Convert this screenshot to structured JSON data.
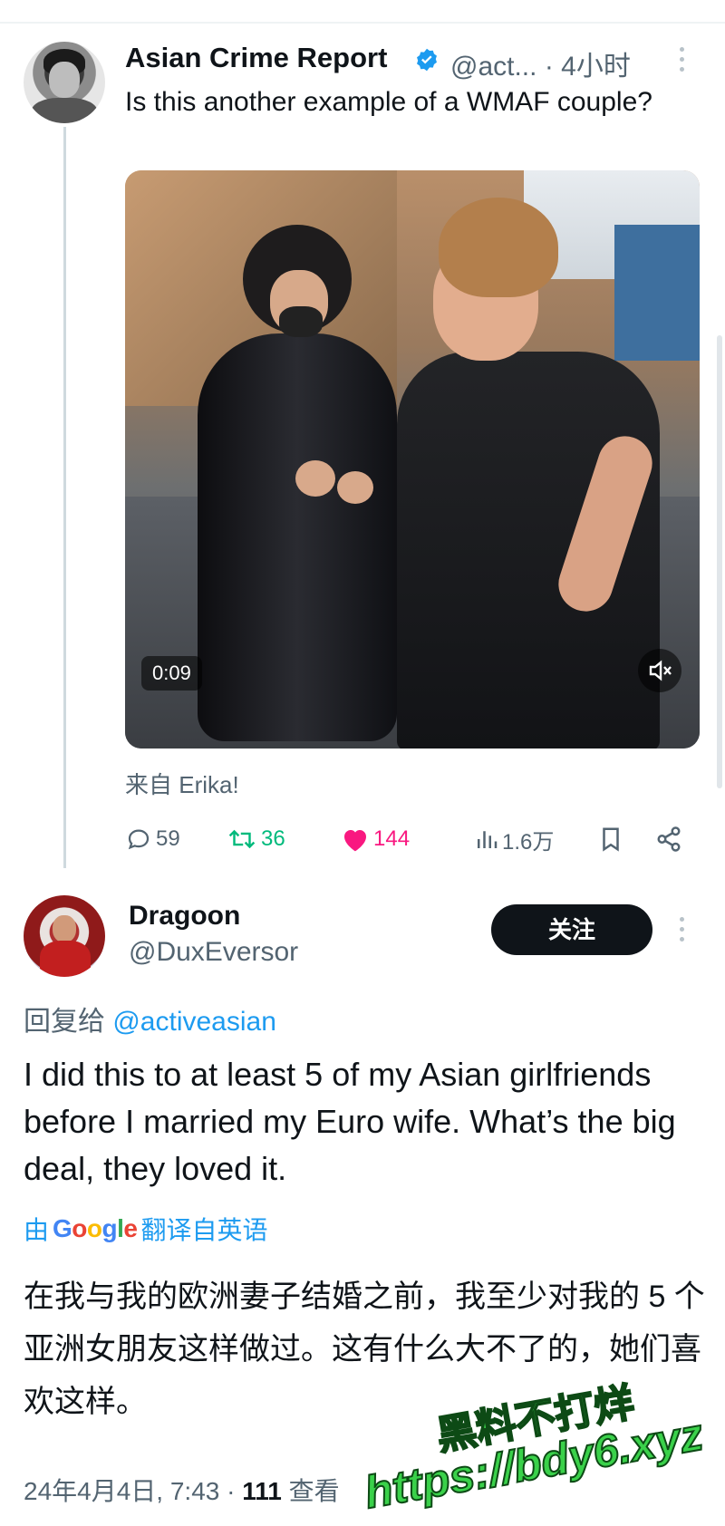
{
  "main_tweet": {
    "author_name": "Asian Crime Report",
    "handle_time": "@act... · 4小时",
    "text": "Is this another example of a WMAF couple?",
    "video": {
      "duration": "0:09"
    },
    "source": "来自 Erika!",
    "actions": {
      "replies": "59",
      "retweets": "36",
      "likes": "144",
      "views": "1.6万"
    }
  },
  "reply_tweet": {
    "author_name": "Dragoon",
    "handle": "@DuxEversor",
    "follow_label": "关注",
    "reply_prefix": "回复给",
    "reply_mention": "@activeasian",
    "text": "I did this to at least 5 of my Asian girlfriends before I married my Euro wife. What’s the big deal, they loved it.",
    "translate_prefix": "由",
    "translate_brand": "Google",
    "translate_suffix": "翻译自英语",
    "translated_text": "在我与我的欧洲妻子结婚之前，我至少对我的 5 个亚洲女朋友这样做过。这有什么大不了的，她们喜欢这样。",
    "meta_datetime": "24年4月4日, 7:43 · ",
    "meta_views": "111",
    "meta_views_label": " 查看"
  },
  "watermark": {
    "line1": "黑料不打烊",
    "line2": "https://bdy6.xyz"
  },
  "colors": {
    "accent": "#1d9bf0",
    "retweet": "#00ba7c",
    "like": "#f91880",
    "text": "#0f1419",
    "secondary": "#536471",
    "watermark": "#3ad14a"
  },
  "icons": [
    "verified-badge-icon",
    "more-icon",
    "reply-icon",
    "retweet-icon",
    "like-icon",
    "views-icon",
    "bookmark-icon",
    "share-icon",
    "mute-icon"
  ]
}
